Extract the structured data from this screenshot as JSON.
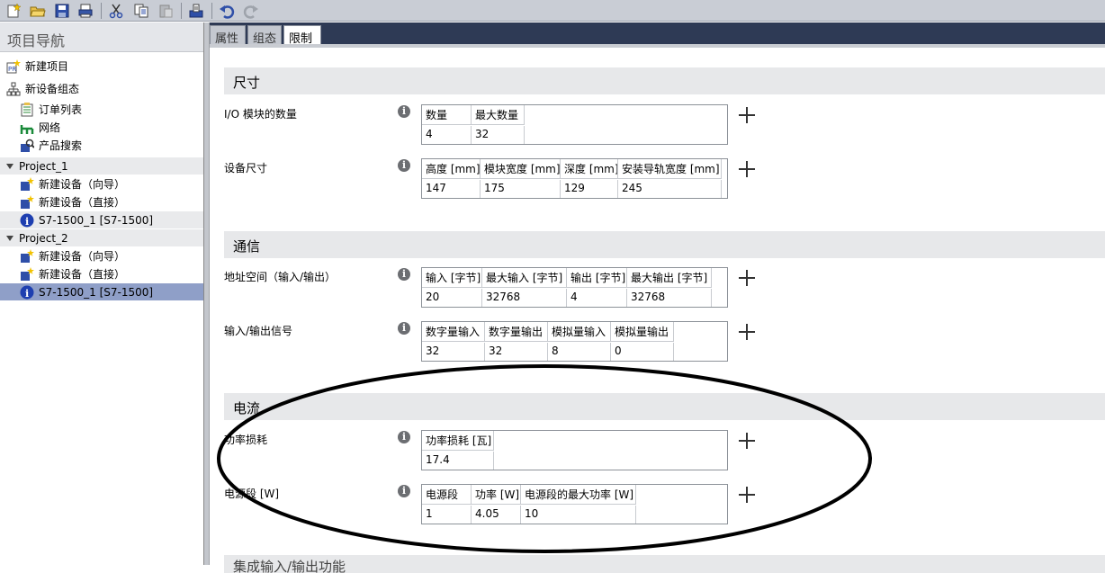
{
  "toolbar": {
    "icons": [
      "new-project-icon",
      "open-project-icon",
      "save-icon",
      "print-icon",
      "cut-icon",
      "copy-icon",
      "paste-icon",
      "compile-icon",
      "undo-icon",
      "redo-icon"
    ]
  },
  "nav": {
    "title": "项目导航",
    "items": [
      {
        "label": "新建项目",
        "icon": "new-project-icon"
      },
      {
        "label": "新设备组态",
        "icon": "device-config-icon"
      },
      {
        "label": "订单列表",
        "icon": "order-list-icon"
      },
      {
        "label": "网络",
        "icon": "network-icon"
      },
      {
        "label": "产品搜索",
        "icon": "product-search-icon"
      },
      {
        "label": "Project_1",
        "icon": "expand-triangle-icon"
      },
      {
        "label": "新建设备（向导）",
        "icon": "new-device-icon"
      },
      {
        "label": "新建设备（直接）",
        "icon": "new-device-icon"
      },
      {
        "label": "S7-1500_1   [S7-1500]",
        "icon": "info-icon"
      },
      {
        "label": "Project_2",
        "icon": "expand-triangle-icon"
      },
      {
        "label": "新建设备（向导）",
        "icon": "new-device-icon"
      },
      {
        "label": "新建设备（直接）",
        "icon": "new-device-icon"
      },
      {
        "label": "S7-1500_1   [S7-1500]",
        "icon": "info-icon"
      }
    ]
  },
  "tabs": [
    "属性",
    "组态",
    "限制"
  ],
  "sections": [
    {
      "title": "尺寸"
    },
    {
      "title": "通信"
    },
    {
      "title": "电流"
    },
    {
      "title": "集成输入/输出功能"
    }
  ],
  "rows": [
    {
      "label": "I/O 模块的数量",
      "headers": [
        "数量",
        "最大数量"
      ],
      "values": [
        "4",
        "32"
      ]
    },
    {
      "label": "设备尺寸",
      "headers": [
        "高度 [mm]",
        "模块宽度 [mm]",
        "深度 [mm]",
        "安装导轨宽度 [mm]"
      ],
      "values": [
        "147",
        "175",
        "129",
        "245"
      ]
    },
    {
      "label": "地址空间（输入/输出）",
      "headers": [
        "输入 [字节]",
        "最大输入 [字节]",
        "输出 [字节]",
        "最大输出 [字节]"
      ],
      "values": [
        "20",
        "32768",
        "4",
        "32768"
      ]
    },
    {
      "label": "输入/输出信号",
      "headers": [
        "数字量输入",
        "数字量输出",
        "模拟量输入",
        "模拟量输出"
      ],
      "values": [
        "32",
        "32",
        "8",
        "0"
      ]
    },
    {
      "label": "功率损耗",
      "headers": [
        "功率损耗 [瓦]"
      ],
      "values": [
        "17.4"
      ]
    },
    {
      "label": "电源段 [W]",
      "headers": [
        "电源段",
        "功率 [W]",
        "电源段的最大功率 [W]"
      ],
      "values": [
        "1",
        "4.05",
        "10"
      ]
    }
  ],
  "info_glyph": "i",
  "colors": {
    "selection": "#8f9fc8",
    "tabbar": "#2e3a55",
    "section_bg": "#e7e8ea"
  }
}
